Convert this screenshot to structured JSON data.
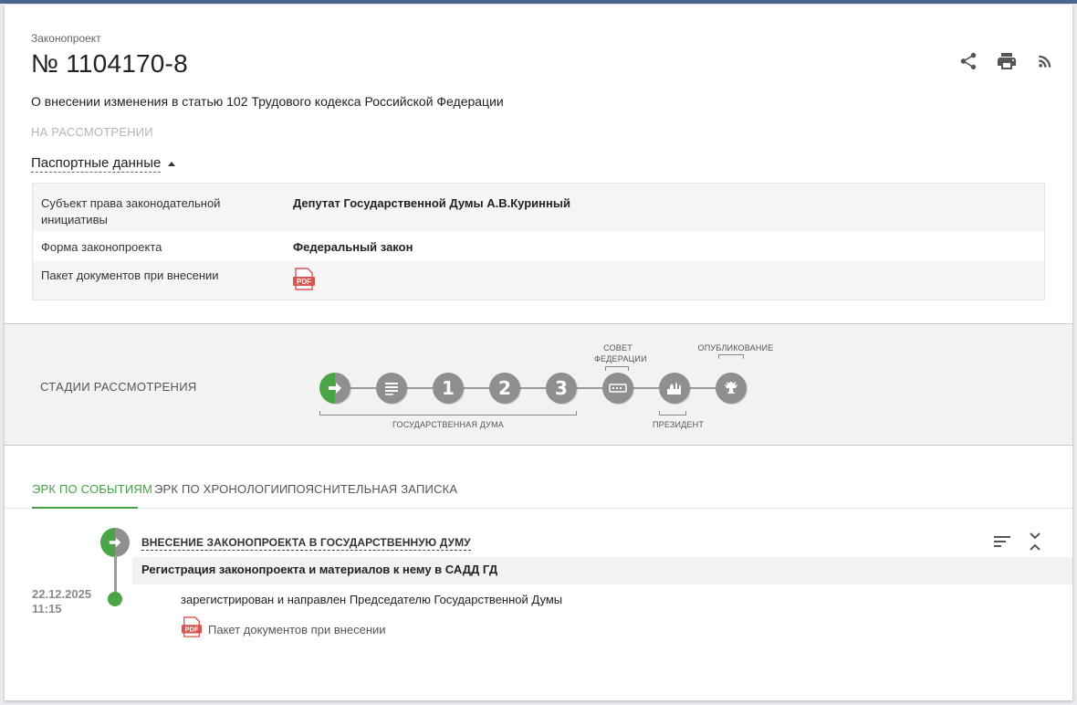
{
  "header": {
    "kicker": "Законопроект",
    "number": "№ 1104170-8",
    "title": "О внесении изменения в статью 102 Трудового кодекса Российской Федерации",
    "status": "НА РАССМОТРЕНИИ"
  },
  "actions": [
    {
      "name": "share-icon"
    },
    {
      "name": "print-icon"
    },
    {
      "name": "rss-icon"
    }
  ],
  "passport": {
    "toggle_label": "Паспортные данные",
    "rows": [
      {
        "key": "Субъект права законодательной инициативы",
        "value": "Депутат Государственной Думы А.В.Куринный"
      },
      {
        "key": "Форма законопроекта",
        "value": "Федеральный закон"
      },
      {
        "key": "Пакет документов при внесении",
        "icon": "pdf-icon"
      }
    ]
  },
  "stages": {
    "title": "СТАДИИ РАССМОТРЕНИЯ",
    "items": [
      {
        "name": "stage-introduction",
        "icon": "arrow-right-icon",
        "active": true
      },
      {
        "name": "stage-preliminary",
        "icon": "document-list-icon"
      },
      {
        "name": "stage-reading-1",
        "label": "1"
      },
      {
        "name": "stage-reading-2",
        "label": "2"
      },
      {
        "name": "stage-reading-3",
        "label": "3"
      },
      {
        "name": "stage-federation-council",
        "icon": "council-icon"
      },
      {
        "name": "stage-president",
        "icon": "kremlin-icon"
      },
      {
        "name": "stage-publication",
        "icon": "eagle-emblem-icon"
      }
    ],
    "captions": {
      "duma": "ГОСУДАРСТВЕННАЯ ДУМА",
      "council": "СОВЕТ ФЕДЕРАЦИИ",
      "president": "ПРЕЗИДЕНТ",
      "publication": "ОПУБЛИКОВАНИЕ"
    }
  },
  "tabs": [
    {
      "label": "ЭРК ПО СОБЫТИЯМ",
      "active": true
    },
    {
      "label": "ЭРК ПО ХРОНОЛОГИИ"
    },
    {
      "label": "ПОЯСНИТЕЛЬНАЯ ЗАПИСКА"
    }
  ],
  "event": {
    "title": "ВНЕСЕНИЕ ЗАКОНОПРОЕКТА В ГОСУДАРСТВЕННУЮ ДУМУ",
    "subtitle": "Регистрация законопроекта и материалов к нему в САДД ГД",
    "date": "22.12.2025",
    "time": "11:15",
    "text": "зарегистрирован и направлен Председателю Государственной Думы",
    "document": "Пакет документов при внесении"
  },
  "colors": {
    "accent_green": "#46a046",
    "stage_gray": "#8f8f8f",
    "top_bar": "#4a6591",
    "pdf_red": "#d9534f"
  }
}
